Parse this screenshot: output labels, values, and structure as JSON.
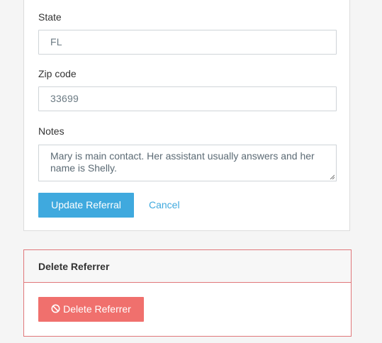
{
  "form": {
    "state": {
      "label": "State",
      "value": "FL"
    },
    "zip": {
      "label": "Zip code",
      "value": "33699"
    },
    "notes": {
      "label": "Notes",
      "value": "Mary is main contact. Her assistant usually answers and her name is Shelly."
    },
    "update_button": "Update Referral",
    "cancel_link": "Cancel"
  },
  "danger_zone": {
    "title": "Delete Referrer",
    "delete_button": "Delete Referrer",
    "delete_icon": "ban-icon"
  },
  "colors": {
    "primary": "#3fa9de",
    "danger": "#f0706d",
    "danger_border": "#e0777a"
  }
}
